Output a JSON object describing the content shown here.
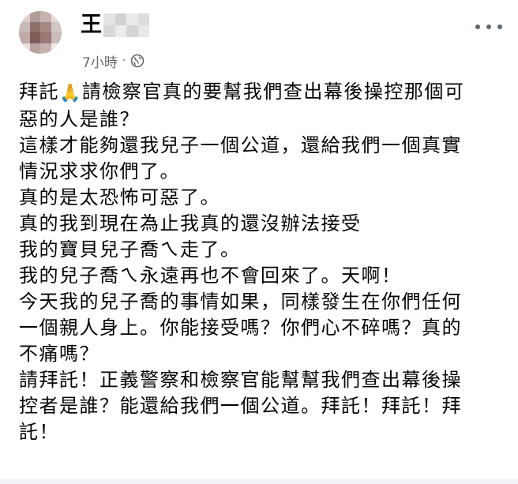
{
  "post": {
    "author_visible": "王",
    "time": "7小時",
    "separator": "·",
    "privacy_icon": "globe-icon",
    "more_icon": "more-options-icon",
    "lines": [
      {
        "before": "拜託",
        "emoji": "🙏",
        "after": "請檢察官真的要幫我們查出幕後操控那個可"
      },
      {
        "text": "惡的人是誰？"
      },
      {
        "text": "這樣才能夠還我兒子一個公道，還給我們一個真實"
      },
      {
        "text": "情況求求你們了。"
      },
      {
        "text": "真的是太恐怖可惡了。"
      },
      {
        "text": "真的我到現在為止我真的還沒辦法接受"
      },
      {
        "text": "我的寶貝兒子喬ㄟ走了。"
      },
      {
        "text": "我的兒子喬ㄟ永遠再也不會回來了。天啊！"
      },
      {
        "text": "今天我的兒子喬的事情如果，同樣發生在你們任何"
      },
      {
        "text": "一個親人身上。你能接受嗎？你們心不碎嗎？真的"
      },
      {
        "text": "不痛嗎？"
      },
      {
        "text": "請拜託！正義警察和檢察官能幫幫我們查出幕後操"
      },
      {
        "text": "控者是誰？能還給我們一個公道。拜託！拜託！拜"
      },
      {
        "text": "託！"
      }
    ]
  },
  "colors": {
    "text": "#050505",
    "meta": "#65676b",
    "background": "#ffffff"
  }
}
